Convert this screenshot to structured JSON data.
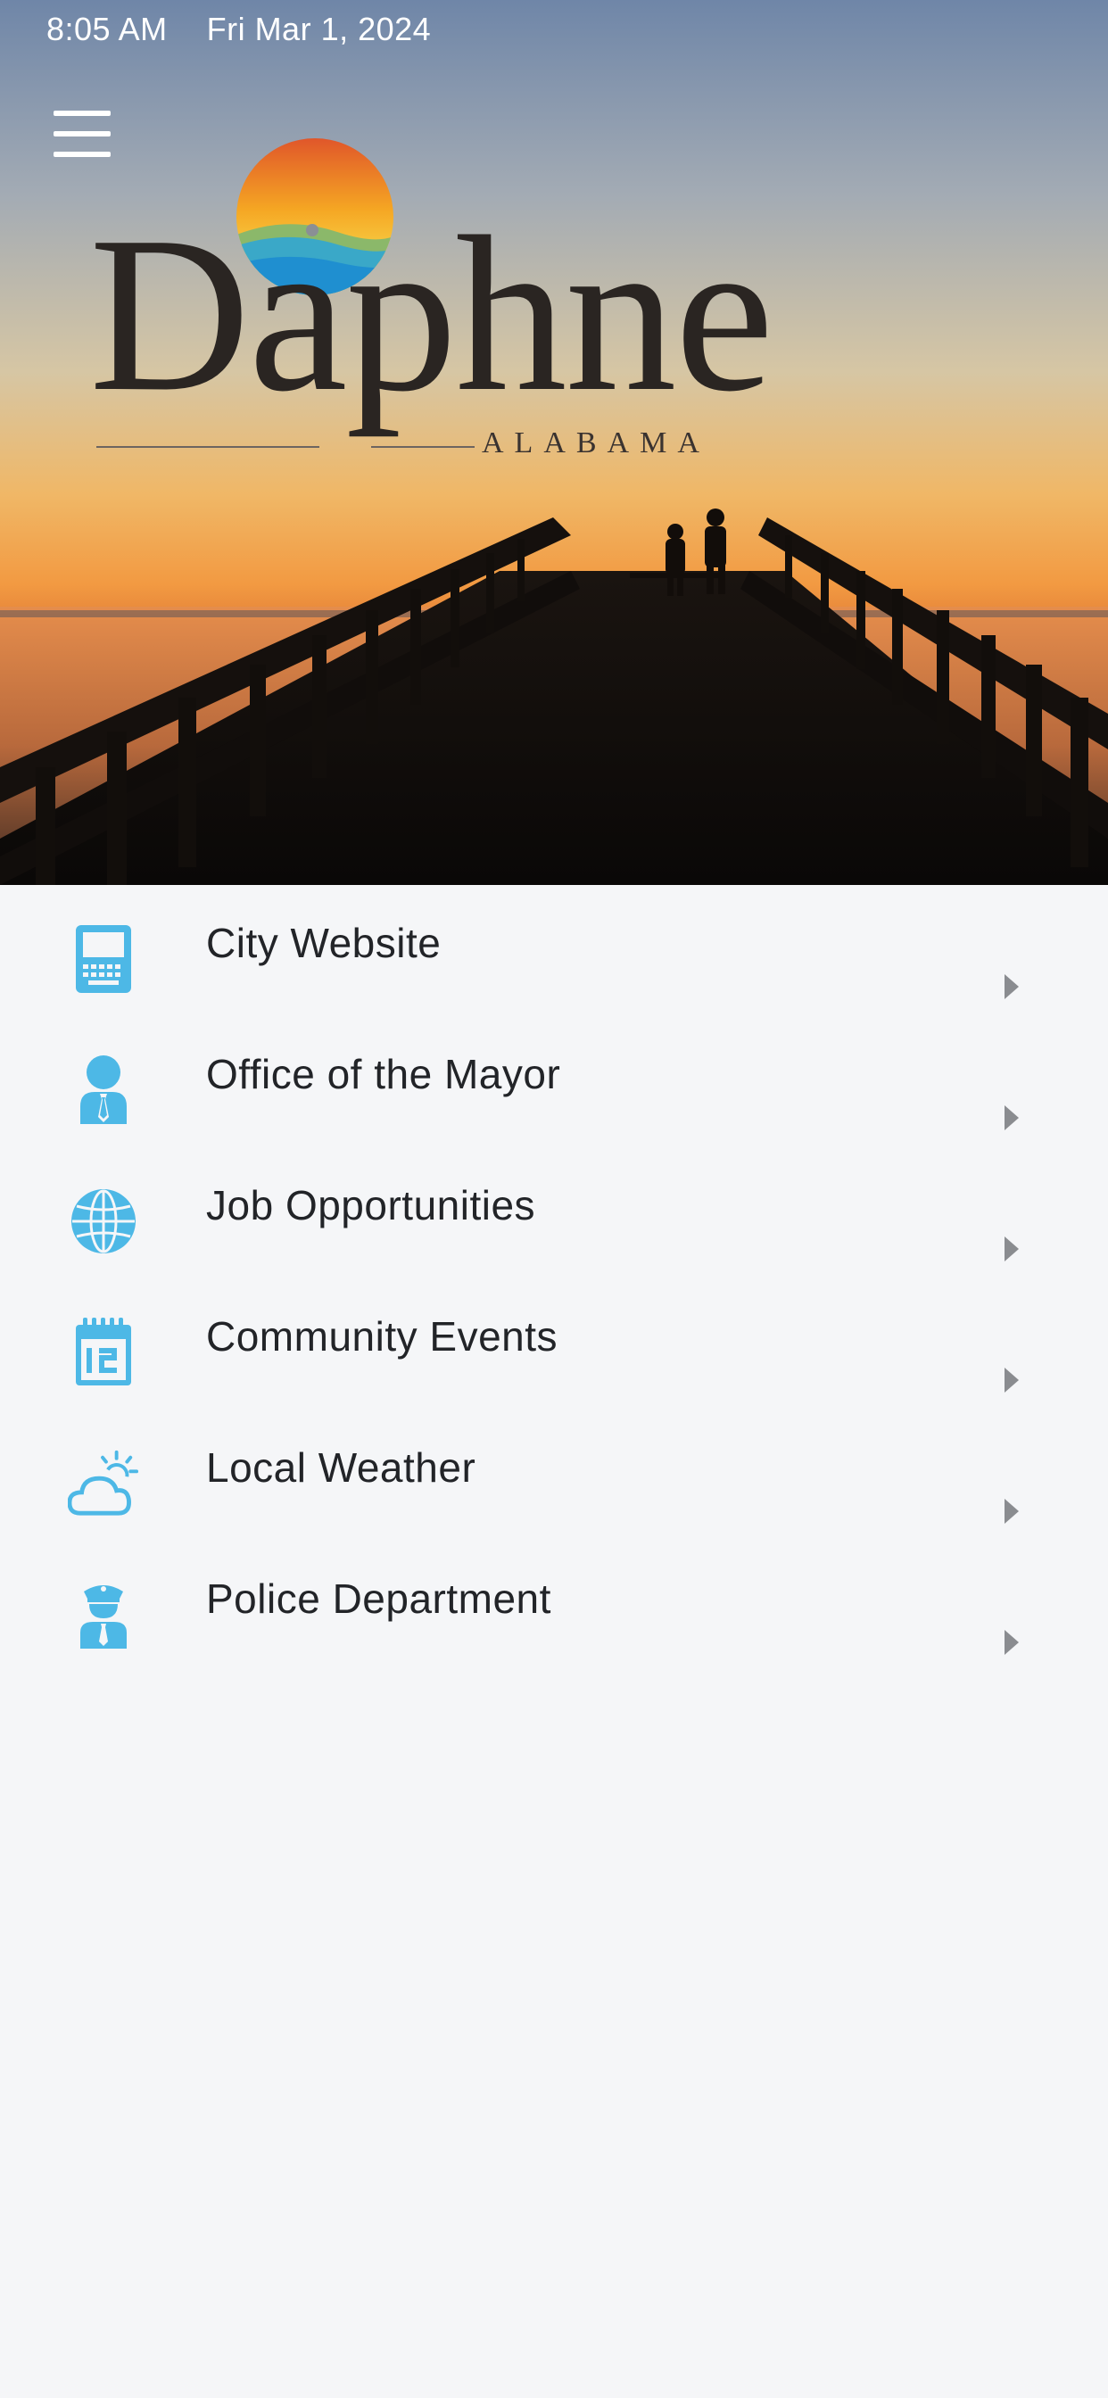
{
  "status_bar": {
    "time": "8:05 AM",
    "date": "Fri Mar 1, 2024"
  },
  "header": {
    "menu_icon": "hamburger-menu-icon",
    "logo_word": "Daphne",
    "logo_subtitle": "ALABAMA",
    "hero_image": "sunset over wooden pier with two silhouetted people"
  },
  "accent_color": "#4db8e6",
  "menu": {
    "items": [
      {
        "label": "City Website",
        "icon": "computer-icon"
      },
      {
        "label": "Office of the Mayor",
        "icon": "person-tie-icon"
      },
      {
        "label": "Job Opportunities",
        "icon": "globe-icon"
      },
      {
        "label": "Community Events",
        "icon": "calendar-icon"
      },
      {
        "label": "Local Weather",
        "icon": "cloud-sun-icon"
      },
      {
        "label": "Police Department",
        "icon": "police-officer-icon"
      }
    ]
  }
}
